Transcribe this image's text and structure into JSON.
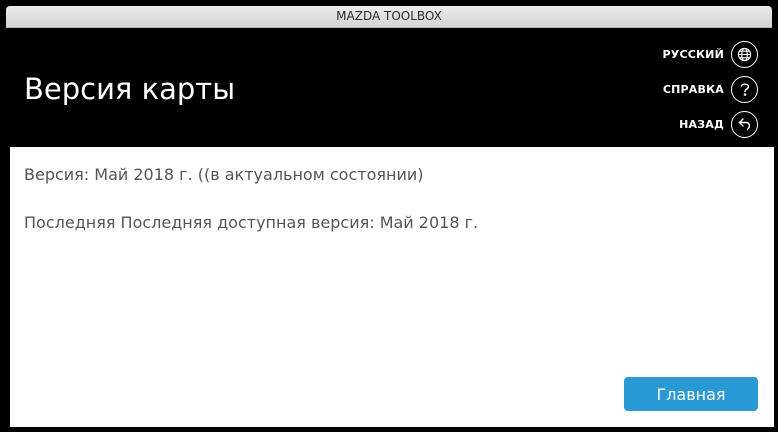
{
  "window": {
    "title": "MAZDA TOOLBOX"
  },
  "header": {
    "title": "Версия карты",
    "nav": {
      "language": {
        "label": "РУССКИЙ",
        "icon": "globe-icon"
      },
      "help": {
        "label": "СПРАВКА",
        "icon": "question-icon"
      },
      "back": {
        "label": "НАЗАД",
        "icon": "back-arrow-icon"
      }
    }
  },
  "content": {
    "version_line": "Версия: Май 2018 г. ((в актуальном состоянии)",
    "latest_line": "Последняя Последняя доступная версия: Май 2018 г.",
    "home_button": "Главная"
  },
  "colors": {
    "header_bg": "#000000",
    "accent": "#2a9ad6",
    "text": "#555555"
  }
}
